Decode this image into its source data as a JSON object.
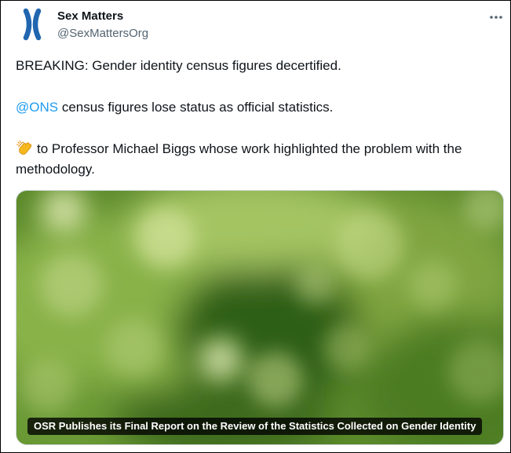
{
  "author": {
    "display_name": "Sex Matters",
    "handle": "@SexMattersOrg",
    "avatar_icon": "chromosome-x-logo"
  },
  "menu": {
    "more_icon": "more-horizontal-icon"
  },
  "tweet": {
    "line1": "BREAKING: Gender identity census figures decertified.",
    "mention": "@ONS",
    "line2_rest": " census figures lose status as official statistics.",
    "clap_icon": "clapping-hands-emoji",
    "line3": "to Professor Michael Biggs whose work highlighted the problem with the methodology."
  },
  "card": {
    "caption": "OSR Publishes its Final Report on the Review of the Statistics Collected on Gender Identity"
  },
  "colors": {
    "link": "#1d9bf0",
    "logo": "#2166b0",
    "text": "#0f1419",
    "muted": "#536471"
  }
}
